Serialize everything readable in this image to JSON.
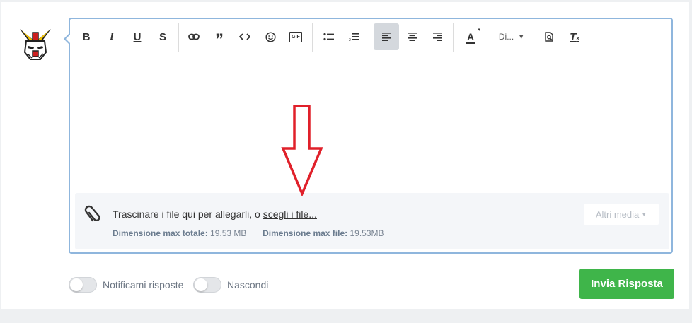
{
  "toolbar": {
    "buttons": [
      "bold",
      "italic",
      "underline",
      "strikethrough",
      "link",
      "quote",
      "code",
      "emoji",
      "gif",
      "bulleted-list",
      "numbered-list",
      "align-left",
      "align-center",
      "align-right",
      "text-color",
      "font-size",
      "preview",
      "clear-formatting"
    ],
    "active": "align-left",
    "font_size_label": "Di...",
    "gif_label": "GIF",
    "text_color_letter": "A",
    "clear_format_label": "T"
  },
  "attachments": {
    "prompt_text": "Trascinare i file qui per allegarli, o ",
    "choose_link": "scegli i file...",
    "max_total_label": "Dimensione max totale:",
    "max_total_value": "19.53 MB",
    "max_file_label": "Dimensione max file:",
    "max_file_value": "19.53MB",
    "more_media_label": "Altri media"
  },
  "footer": {
    "notify_label": "Notificami risposte",
    "hide_label": "Nascondi",
    "notify_on": false,
    "hide_on": false,
    "submit_label": "Invia Risposta"
  },
  "colors": {
    "submit_bg": "#3fb54a",
    "editor_border": "#8fb6dd",
    "annotation_arrow": "#e0202a"
  }
}
